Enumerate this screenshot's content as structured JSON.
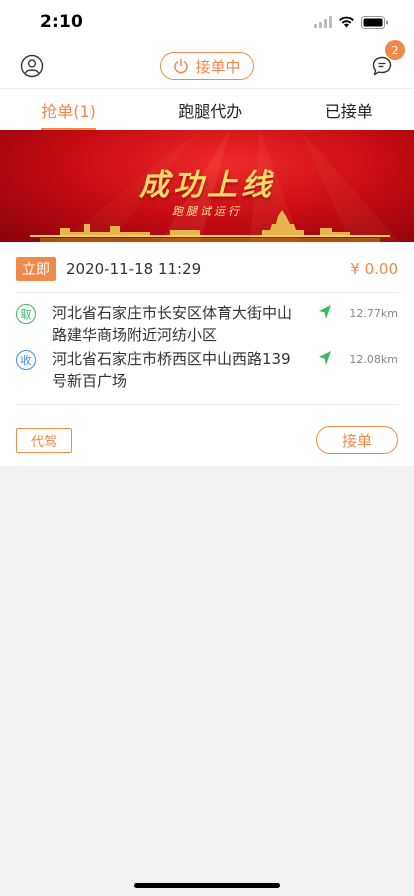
{
  "status": {
    "time": "2:10"
  },
  "header": {
    "online_label": "接单中",
    "message_count": "2"
  },
  "tabs": [
    {
      "label": "抢单(1)",
      "active": true
    },
    {
      "label": "跑腿代办",
      "active": false
    },
    {
      "label": "已接单",
      "active": false
    }
  ],
  "banner": {
    "title": "成功上线",
    "subtitle": "跑腿试运行"
  },
  "order": {
    "tag": "立即",
    "time": "2020-11-18 11:29",
    "price": "¥ 0.00",
    "pickup": {
      "badge": "取",
      "address": "河北省石家庄市长安区体育大街中山路建华商场附近河纺小区",
      "distance": "12.77km"
    },
    "dropoff": {
      "badge": "收",
      "address": "河北省石家庄市桥西区中山西路139号新百广场",
      "distance": "12.08km"
    },
    "type_tag": "代驾",
    "accept_label": "接单"
  },
  "colors": {
    "accent": "#f08a4b",
    "pickup": "#3cb95c",
    "dropoff": "#3a8fe0",
    "banner_red": "#c50b12"
  },
  "icons": [
    "user-icon",
    "power-icon",
    "message-icon",
    "navigation-arrow-icon",
    "wifi-icon",
    "battery-icon",
    "signal-icon"
  ]
}
